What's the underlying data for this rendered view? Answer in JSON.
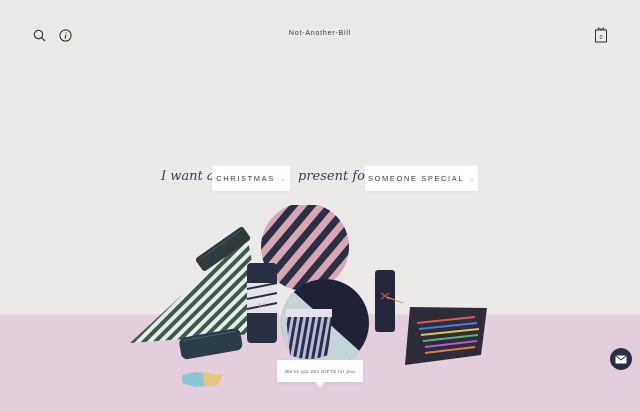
{
  "header": {
    "brand": "Not-Another-Bill",
    "icons": [
      "search-icon",
      "info-icon",
      "gift-bag-icon"
    ],
    "bag_count": "0"
  },
  "hero": {
    "script_prefix": "I want a",
    "occasion": {
      "selected": "CHRISTMAS"
    },
    "script_middle": "present for a",
    "recipient": {
      "selected": "SOMEONE SPECIAL"
    }
  },
  "callout": {
    "text": "We've got 254 GIFTS for you"
  },
  "chat": {
    "icon": "mail-icon"
  },
  "colors": {
    "background": "#ebeae9",
    "floor": "#e3cfdc",
    "navy": "#2b2f44",
    "accent_pink": "#d9a6b4",
    "accent_green": "#3a5a50"
  }
}
